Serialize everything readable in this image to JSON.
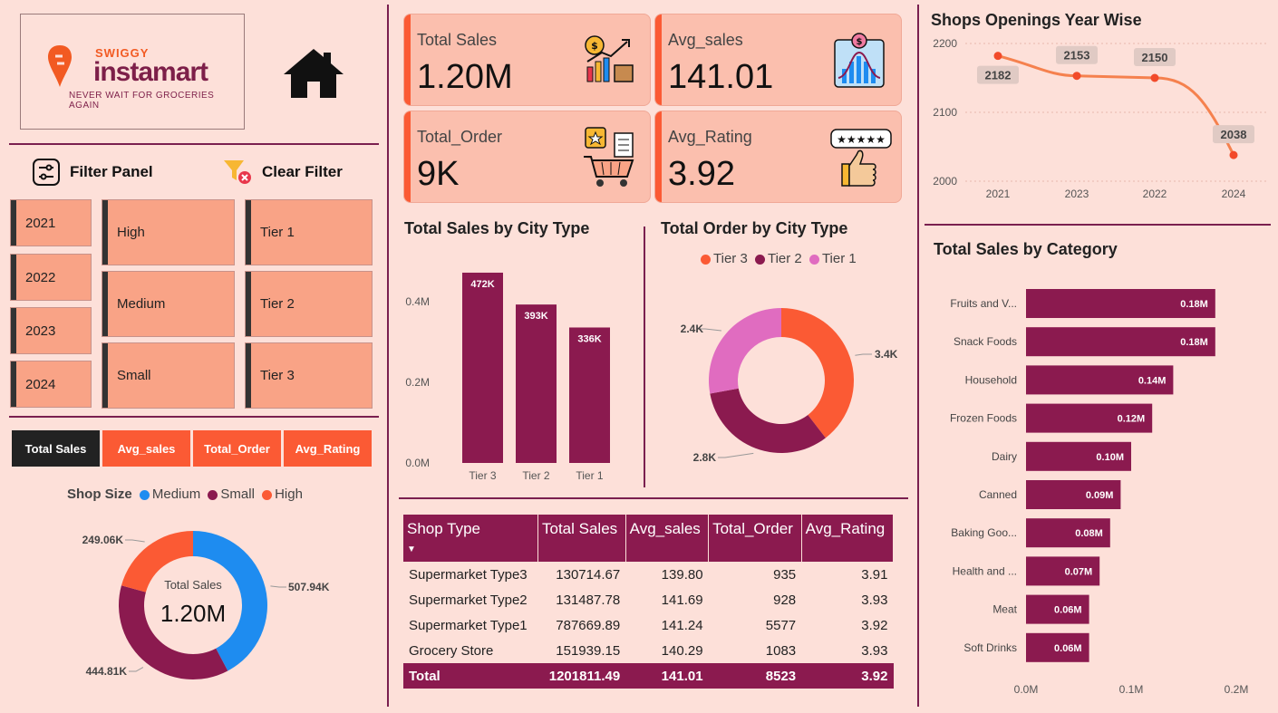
{
  "logo": {
    "brand_top": "SWIGGY",
    "brand_main": "instamart",
    "tagline": "NEVER WAIT FOR GROCERIES AGAIN"
  },
  "nav": {
    "home_icon": "home-icon"
  },
  "filter_panel": {
    "title": "Filter Panel",
    "clear_label": "Clear Filter",
    "icon": "sliders-icon",
    "clear_icon": "funnel-clear-icon"
  },
  "slicers": {
    "years": [
      "2021",
      "2022",
      "2023",
      "2024"
    ],
    "shop_size": [
      "High",
      "Medium",
      "Small"
    ],
    "tiers": [
      "Tier 1",
      "Tier 2",
      "Tier 3"
    ]
  },
  "metric_tabs": [
    {
      "label": "Total Sales",
      "active": true
    },
    {
      "label": "Avg_sales",
      "active": false
    },
    {
      "label": "Total_Order",
      "active": false
    },
    {
      "label": "Avg_Rating",
      "active": false
    }
  ],
  "kpis": [
    {
      "label": "Total Sales",
      "value": "1.20M",
      "icon": "sales-growth-icon"
    },
    {
      "label": "Avg_sales",
      "value": "141.01",
      "icon": "bell-curve-icon"
    },
    {
      "label": "Total_Order",
      "value": "9K",
      "icon": "shopping-cart-icon"
    },
    {
      "label": "Avg_Rating",
      "value": "3.92",
      "icon": "thumbs-up-rating-icon"
    }
  ],
  "shop_size_chart": {
    "legend_title": "Shop Size",
    "center_label": "Total Sales",
    "center_value": "1.20M"
  },
  "titles": {
    "sales_by_city": "Total Sales by City Type",
    "order_by_city": "Total Order by City Type",
    "openings": "Shops Openings Year Wise",
    "sales_by_category": "Total Sales by Category"
  },
  "table": {
    "headers": [
      "Shop Type",
      "Total Sales",
      "Avg_sales",
      "Total_Order",
      "Avg_Rating"
    ],
    "rows": [
      [
        "Supermarket Type3",
        "130714.67",
        "139.80",
        "935",
        "3.91"
      ],
      [
        "Supermarket Type2",
        "131487.78",
        "141.69",
        "928",
        "3.93"
      ],
      [
        "Supermarket Type1",
        "787669.89",
        "141.24",
        "5577",
        "3.92"
      ],
      [
        "Grocery Store",
        "151939.15",
        "140.29",
        "1083",
        "3.93"
      ]
    ],
    "total": [
      "Total",
      "1201811.49",
      "141.01",
      "8523",
      "3.92"
    ]
  },
  "colors": {
    "maroon": "#8b1a4f",
    "orange": "#fb5a34",
    "blue": "#1e8cf0",
    "pink": "#e06cc0",
    "line": "#f5814e"
  },
  "chart_data": [
    {
      "type": "pie",
      "name": "Shop Size",
      "categories": [
        "Medium",
        "Small",
        "High"
      ],
      "values": [
        507.94,
        444.81,
        249.06
      ],
      "labels": [
        "507.94K",
        "444.81K",
        "249.06K"
      ],
      "colors": [
        "#1e8cf0",
        "#8b1a4f",
        "#fb5a34"
      ],
      "donut": true
    },
    {
      "type": "bar",
      "title": "Total Sales by City Type",
      "categories": [
        "Tier 3",
        "Tier 2",
        "Tier 1"
      ],
      "values": [
        472,
        393,
        336
      ],
      "labels": [
        "472K",
        "393K",
        "336K"
      ],
      "yticks": [
        "0.0M",
        "0.2M",
        "0.4M"
      ],
      "ylim": [
        0,
        500
      ]
    },
    {
      "type": "pie",
      "title": "Total Order by City Type",
      "categories": [
        "Tier 3",
        "Tier 2",
        "Tier 1"
      ],
      "values": [
        3.4,
        2.8,
        2.4
      ],
      "labels": [
        "3.4K",
        "2.8K",
        "2.4K"
      ],
      "colors": [
        "#fb5a34",
        "#8b1a4f",
        "#e06cc0"
      ],
      "donut": true
    },
    {
      "type": "line",
      "title": "Shops Openings Year Wise",
      "categories": [
        "2021",
        "2023",
        "2022",
        "2024"
      ],
      "values": [
        2182,
        2153,
        2150,
        2038
      ],
      "yticks": [
        "2000",
        "2100",
        "2200"
      ],
      "ylim": [
        2000,
        2200
      ]
    },
    {
      "type": "bar",
      "orientation": "horizontal",
      "title": "Total Sales by Category",
      "categories": [
        "Fruits and V...",
        "Snack Foods",
        "Household",
        "Frozen Foods",
        "Dairy",
        "Canned",
        "Baking Goo...",
        "Health and ...",
        "Meat",
        "Soft Drinks"
      ],
      "values": [
        0.18,
        0.18,
        0.14,
        0.12,
        0.1,
        0.09,
        0.08,
        0.07,
        0.06,
        0.06
      ],
      "labels": [
        "0.18M",
        "0.18M",
        "0.14M",
        "0.12M",
        "0.10M",
        "0.09M",
        "0.08M",
        "0.07M",
        "0.06M",
        "0.06M"
      ],
      "xticks": [
        "0.0M",
        "0.1M",
        "0.2M"
      ],
      "xlim": [
        0,
        0.2
      ]
    }
  ]
}
